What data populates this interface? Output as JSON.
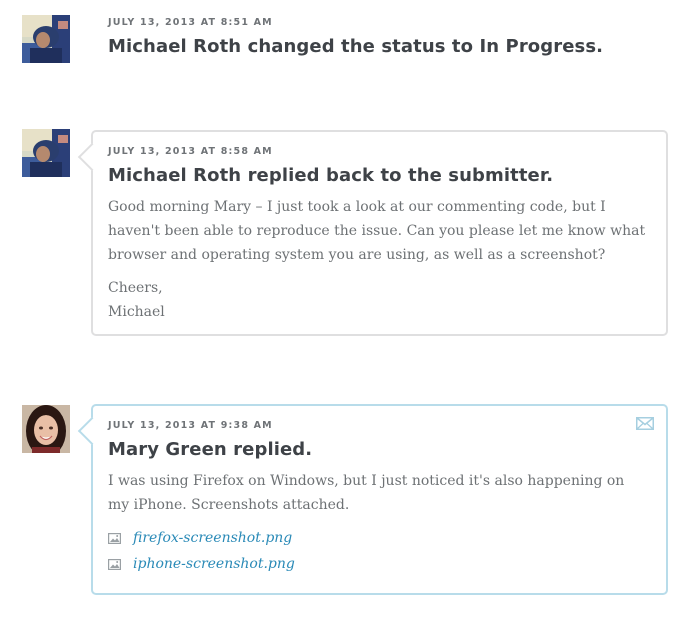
{
  "entries": [
    {
      "date": "JULY 13, 2013 AT 8:51 AM",
      "title": "Michael Roth changed the status to In Progress.",
      "avatar": "avatar-michael"
    },
    {
      "date": "JULY 13, 2013 AT 8:58 AM",
      "title": "Michael Roth replied back to the submitter.",
      "avatar": "avatar-michael",
      "paragraphs": [
        "Good morning Mary – I just took a look at our commenting code, but I haven't been able to reproduce the issue. Can you please let me know what browser and operating system you are using, as well as a screenshot?",
        "Cheers,",
        "Michael"
      ]
    },
    {
      "date": "JULY 13, 2013 AT 9:38 AM",
      "title": "Mary Green replied.",
      "avatar": "avatar-mary",
      "paragraphs": [
        "I was using Firefox on Windows, but I just noticed it's also happening on my iPhone. Screenshots attached."
      ],
      "attachments": [
        {
          "name": "firefox-screenshot.png",
          "icon": "image-icon"
        },
        {
          "name": "iphone-screenshot.png",
          "icon": "image-icon"
        }
      ],
      "action_icon": "mail-icon"
    }
  ],
  "colors": {
    "text_dark": "#3e4247",
    "text_body": "#6d7174",
    "border_grey": "#dfdfe0",
    "border_blue": "#b8dcea",
    "link": "#2a8ab7"
  }
}
